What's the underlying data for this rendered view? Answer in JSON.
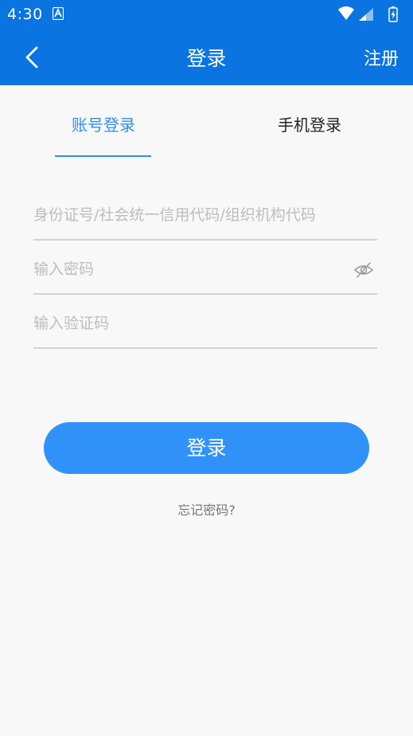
{
  "status_bar": {
    "time": "4:30",
    "icons": [
      "notification-a-icon",
      "wifi-icon",
      "signal-icon",
      "battery-icon"
    ]
  },
  "app_bar": {
    "title": "登录",
    "back_icon": "chevron-left-icon",
    "register_label": "注册"
  },
  "tabs": [
    {
      "label": "账号登录",
      "active": true
    },
    {
      "label": "手机登录",
      "active": false
    }
  ],
  "form": {
    "id_placeholder": "身份证号/社会统一信用代码/组织机构代码",
    "password_placeholder": "输入密码",
    "password_toggle_icon": "eye-off-icon",
    "code_placeholder": "输入验证码"
  },
  "login_button": "登录",
  "forgot_password": "忘记密码?",
  "colors": {
    "primary": "#0a74e1",
    "button": "#3092f9",
    "tab_active": "#2f8ef0",
    "background": "#f8f8f8"
  }
}
